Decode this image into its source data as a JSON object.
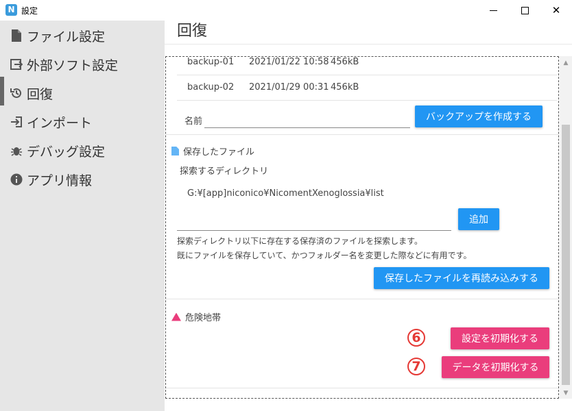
{
  "window": {
    "title": "設定",
    "app_logo": "N"
  },
  "sidebar": {
    "items": [
      {
        "icon": "file-icon",
        "label": "ファイル設定"
      },
      {
        "icon": "external-software-icon",
        "label": "外部ソフト設定"
      },
      {
        "icon": "restore-icon",
        "label": "回復",
        "active": true
      },
      {
        "icon": "import-icon",
        "label": "インポート"
      },
      {
        "icon": "bug-icon",
        "label": "デバッグ設定"
      },
      {
        "icon": "info-icon",
        "label": "アプリ情報"
      }
    ]
  },
  "main": {
    "title": "回復",
    "backups": [
      {
        "name": "backup-01",
        "datetime": "2021/01/22 10:58",
        "size": "456kB"
      },
      {
        "name": "backup-02",
        "datetime": "2021/01/29 00:31",
        "size": "456kB"
      }
    ],
    "backup_name_label": "名前",
    "backup_name_value": "",
    "create_backup_label": "バックアップを作成する",
    "saved_files": {
      "heading": "保存したファイル",
      "search_dir_label": "探索するディレクトリ",
      "directory_path": "G:¥[app]niconico¥NicomentXenoglossia¥list",
      "dir_input_value": "",
      "add_label": "追加",
      "description_1": "探索ディレクトリ以下に存在する保存済のファイルを探索します。",
      "description_2": "既にファイルを保存していて、かつフォルダー名を変更した際などに有用です。",
      "reload_label": "保存したファイルを再読み込みする"
    },
    "danger_zone": {
      "heading": "危険地帯",
      "reset_settings_label": "設定を初期化する",
      "reset_data_label": "データを初期化する",
      "marker_settings": "⑥",
      "marker_data": "⑦"
    }
  },
  "colors": {
    "sidebar_bg": "#e6e6e6",
    "primary_button": "#2196f3",
    "danger_button": "#ea3d7c",
    "marker": "#e53935"
  }
}
